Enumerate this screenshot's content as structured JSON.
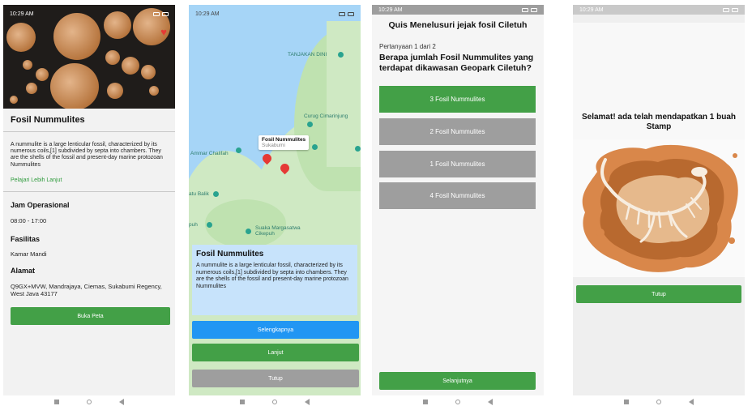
{
  "screen1": {
    "status_time": "10:29 AM",
    "title": "Fosil Nummulites",
    "description": "A nummulite is a large lenticular fossil, characterized by its numerous coils,[1] subdivided by septa into chambers. They are the shells of the fossil and present-day marine protozoan Nummulites",
    "learn_more": "Pelajari Lebih Lanjut",
    "hours_heading": "Jam Operasional",
    "hours_value": "08:00 - 17:00",
    "facilities_heading": "Fasilitas",
    "facilities_value": "Kamar Mandi",
    "address_heading": "Alamat",
    "address_value": "Q9GX+MVW, Mandrajaya, Ciemas, Sukabumi Regency, West Java 43177",
    "map_button": "Buka Peta",
    "favorite_icon": "heart-icon"
  },
  "screen2": {
    "status_time": "10:29 AM",
    "map_labels": {
      "tanjakan": "TANJAKAN DINI",
      "curug": "Curug Cimarinjung",
      "ammar": "Ammar Chalifah",
      "batu": "atu Balik",
      "puh": "puh",
      "suaka": "Suaka Margasatwa Cikepuh"
    },
    "callout_title": "Fosil Nummulites",
    "callout_subtitle": "Sukabumi",
    "card_title": "Fosil Nummulites",
    "card_description": "A nummulite is a large lenticular fossil, characterized by its numerous coils,[1] subdivided by septa into chambers. They are the shells of the fossil and present-day marine protozoan Nummulites",
    "btn_more": "Selengkapnya",
    "btn_next": "Lanjut",
    "btn_close": "Tutup"
  },
  "screen3": {
    "status_time": "10:29 AM",
    "title": "Quis Menelusuri jejak fosil Ciletuh",
    "counter": "Pertanyaan 1 dari 2",
    "question": "Berapa jumlah Fosil Nummulites yang terdapat dikawasan Geopark Ciletuh?",
    "options": [
      "3 Fosil Nummulites",
      "2 Fosil Nummulites",
      "1 Fosil Nummulites",
      "4 Fosil Nummulites"
    ],
    "selected_color": "#43a047",
    "unselected_color": "#9e9e9e",
    "next_button": "Selanjutnya"
  },
  "screen4": {
    "status_time": "10:29 AM",
    "congrats": "Selamat! ada telah mendapatkan 1 buah Stamp",
    "close_button": "Tutup"
  },
  "colors": {
    "green": "#43a047",
    "blue": "#2196f3",
    "gray": "#9e9e9e",
    "link_green": "#2e9b3c"
  }
}
